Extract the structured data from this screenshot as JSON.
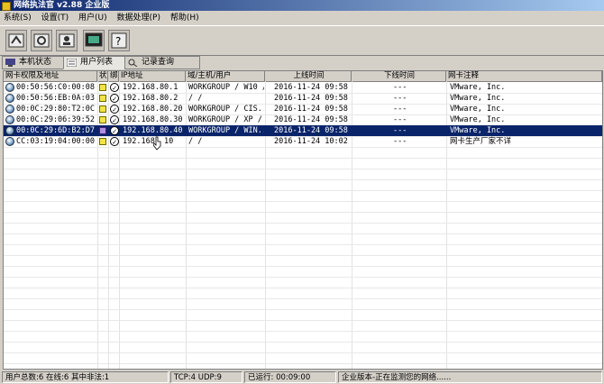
{
  "window": {
    "title": "网络执法官 v2.88 企业版"
  },
  "menu": [
    {
      "label": "系统(S)"
    },
    {
      "label": "设置(T)"
    },
    {
      "label": "用户(U)"
    },
    {
      "label": "数据处理(P)"
    },
    {
      "label": "帮助(H)"
    }
  ],
  "toolbar": [
    {
      "icon": "scan-icon"
    },
    {
      "icon": "settings-icon"
    },
    {
      "icon": "user-manage-icon"
    },
    {
      "icon": "monitor-icon"
    },
    {
      "icon": "help-icon"
    }
  ],
  "tabs": [
    {
      "label": "本机状态"
    },
    {
      "label": "用户列表"
    },
    {
      "label": "记录查询"
    }
  ],
  "table": {
    "headers": [
      "网卡权限及地址",
      "状",
      "绑",
      "IP地址",
      "域/主机/用户",
      "上线时间",
      "下线时间",
      "网卡注释"
    ],
    "rows": [
      {
        "mac": "00:50:56:C0:00:08",
        "ip": "192.168.80.1",
        "host": "WORKGROUP / W10 /",
        "online": "2016-11-24 09:58",
        "offline": "---",
        "note": "VMware, Inc.",
        "selected": false,
        "flag": "yellow"
      },
      {
        "mac": "00:50:56:EB:0A:03",
        "ip": "192.168.80.2",
        "host": "/  /",
        "online": "2016-11-24 09:58",
        "offline": "---",
        "note": "VMware, Inc.",
        "selected": false,
        "flag": "yellow"
      },
      {
        "mac": "00:0C:29:80:T2:0C",
        "ip": "192.168.80.20",
        "host": "WORKGROUP / CIS...",
        "online": "2016-11-24 09:58",
        "offline": "---",
        "note": "VMware, Inc.",
        "selected": false,
        "flag": "yellow"
      },
      {
        "mac": "00:0C:29:06:39:52",
        "ip": "192.168.80.30",
        "host": "WORKGROUP / XP /",
        "online": "2016-11-24 09:58",
        "offline": "---",
        "note": "VMware, Inc.",
        "selected": false,
        "flag": "yellow"
      },
      {
        "mac": "00:0C:29:6D:B2:D7",
        "ip": "192.168.80.40",
        "host": "WORKGROUP / WIN...",
        "online": "2016-11-24 09:58",
        "offline": "---",
        "note": "VMware, Inc.",
        "selected": true,
        "flag": "purple"
      },
      {
        "mac": "CC:03:19:04:00:00",
        "ip": "192.168.  10",
        "host": "/  /",
        "online": "2016-11-24 10:02",
        "offline": "---",
        "note": "网卡生产厂家不详",
        "selected": false,
        "flag": "yellow"
      }
    ]
  },
  "status": {
    "users": "用户总数:6 在线:6 其中非法:1",
    "ports": "TCP:4 UDP:9",
    "uptime": "已运行: 00:09:00",
    "message": "企业版本-正在监测您的网络......"
  }
}
